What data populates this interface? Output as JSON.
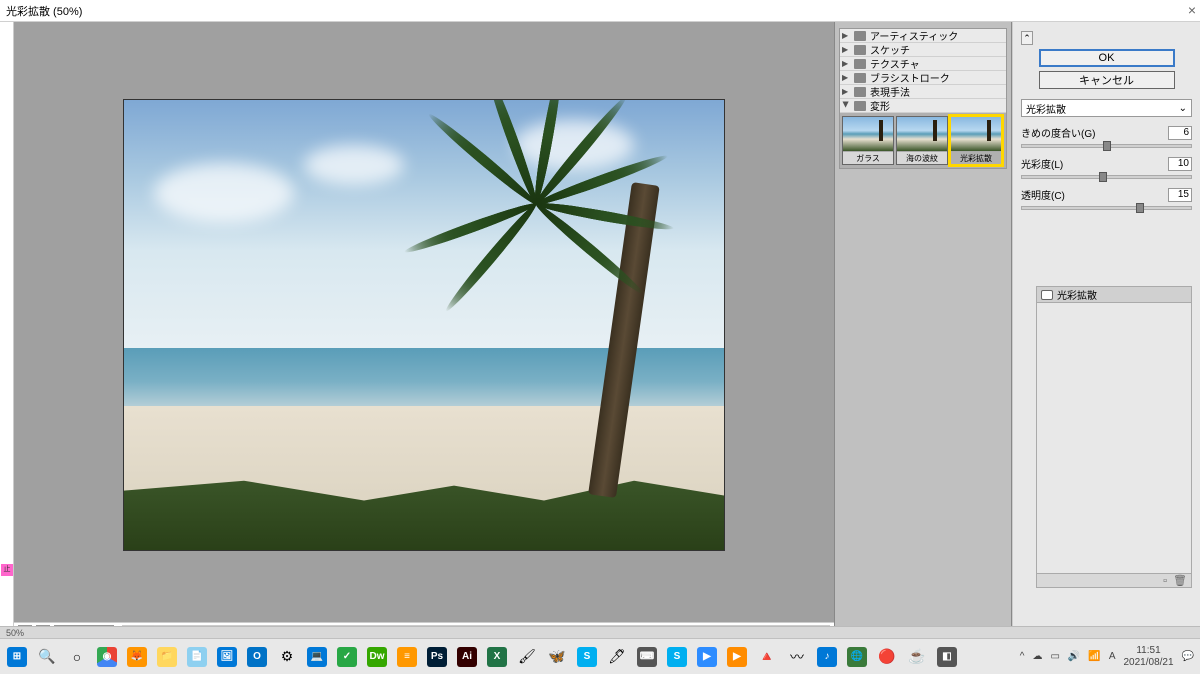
{
  "window": {
    "title": "光彩拡散 (50%)"
  },
  "zoom": {
    "value": "50%",
    "minus": "−",
    "plus": "+"
  },
  "filter_panel": {
    "categories": [
      {
        "label": "アーティスティック",
        "open": false
      },
      {
        "label": "スケッチ",
        "open": false
      },
      {
        "label": "テクスチャ",
        "open": false
      },
      {
        "label": "ブラシストローク",
        "open": false
      },
      {
        "label": "表現手法",
        "open": false
      },
      {
        "label": "変形",
        "open": true
      }
    ],
    "thumbs": [
      {
        "label": "ガラス",
        "selected": false
      },
      {
        "label": "海の波紋",
        "selected": false
      },
      {
        "label": "光彩拡散",
        "selected": true
      }
    ]
  },
  "params": {
    "ok": "OK",
    "cancel": "キャンセル",
    "filter_name": "光彩拡散",
    "rows": [
      {
        "label": "きめの度合い(G)",
        "value": "6",
        "pos": 50
      },
      {
        "label": "光彩度(L)",
        "value": "10",
        "pos": 48
      },
      {
        "label": "透明度(C)",
        "value": "15",
        "pos": 70
      }
    ]
  },
  "layers": {
    "name": "光彩拡散"
  },
  "statusbar": {
    "zoom": "50%"
  },
  "taskbar": {
    "time": "11:51",
    "date": "2021/08/21"
  }
}
